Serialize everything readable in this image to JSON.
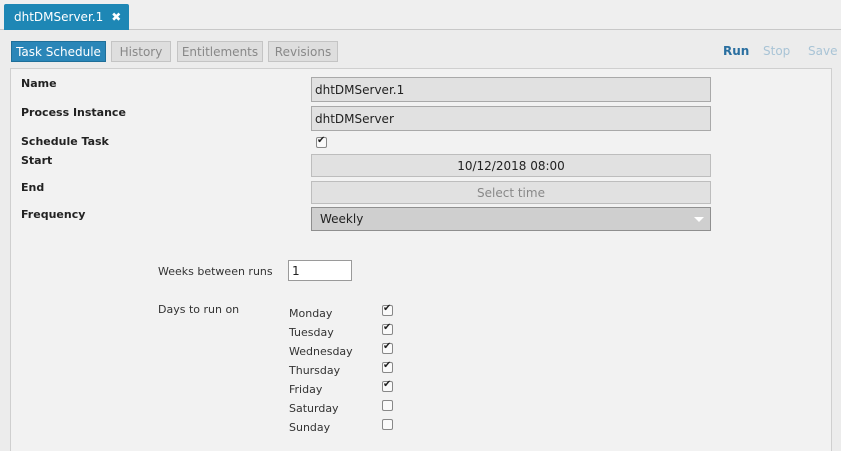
{
  "doc_tab": {
    "label": "dhtDMServer.1",
    "close": "✖"
  },
  "tabs": [
    {
      "label": "Task Schedule",
      "active": true
    },
    {
      "label": "History",
      "active": false
    },
    {
      "label": "Entitlements",
      "active": false
    },
    {
      "label": "Revisions",
      "active": false
    }
  ],
  "actions": {
    "run": "Run",
    "stop": "Stop",
    "save": "Save"
  },
  "form": {
    "name_label": "Name",
    "name_value": "dhtDMServer.1",
    "process_label": "Process Instance",
    "process_value": "dhtDMServer",
    "schedule_label": "Schedule Task",
    "schedule_checked": true,
    "start_label": "Start",
    "start_value": "10/12/2018 08:00",
    "end_label": "End",
    "end_placeholder": "Select time",
    "frequency_label": "Frequency",
    "frequency_value": "Weekly"
  },
  "weekly": {
    "weeks_label": "Weeks between runs",
    "weeks_value": "1",
    "days_label": "Days to run on",
    "days": [
      {
        "label": "Monday",
        "checked": true
      },
      {
        "label": "Tuesday",
        "checked": true
      },
      {
        "label": "Wednesday",
        "checked": true
      },
      {
        "label": "Thursday",
        "checked": true
      },
      {
        "label": "Friday",
        "checked": true
      },
      {
        "label": "Saturday",
        "checked": false
      },
      {
        "label": "Sunday",
        "checked": false
      }
    ]
  }
}
